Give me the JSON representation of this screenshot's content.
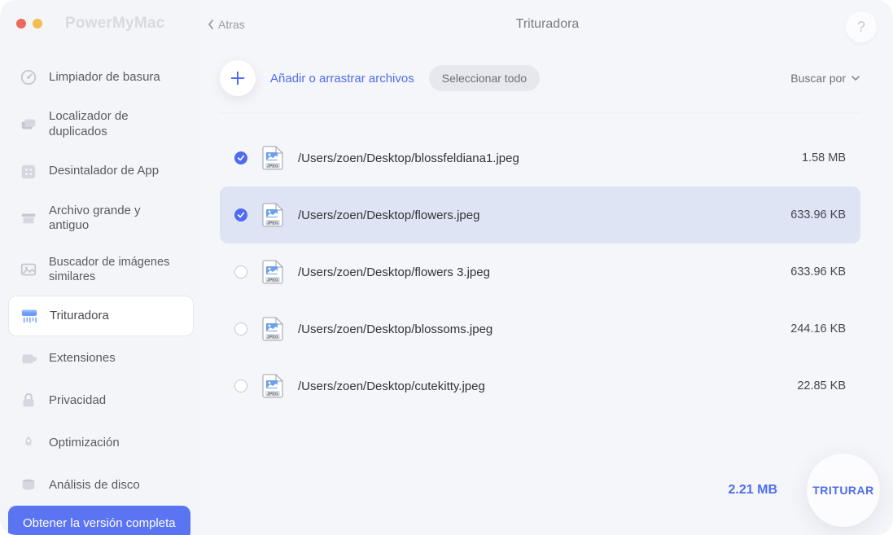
{
  "app_name": "PowerMyMac",
  "header": {
    "back_label": "Atras",
    "title": "Trituradora",
    "help_label": "?"
  },
  "sidebar": {
    "items": [
      {
        "label": "Limpiador de basura"
      },
      {
        "label": "Localizador de duplicados"
      },
      {
        "label": "Desintalador de App"
      },
      {
        "label": "Archivo grande y antiguo"
      },
      {
        "label": "Buscador de imágenes similares"
      },
      {
        "label": "Trituradora"
      },
      {
        "label": "Extensiones"
      },
      {
        "label": "Privacidad"
      },
      {
        "label": "Optimización"
      },
      {
        "label": "Análisis de disco"
      }
    ],
    "upgrade_label": "Obtener la versión completa"
  },
  "toolbar": {
    "add_label": "Añadir o arrastrar archivos",
    "select_all_label": "Seleccionar todo",
    "search_by_label": "Buscar por"
  },
  "files": [
    {
      "checked": true,
      "highlight": false,
      "path": "/Users/zoen/Desktop/blossfeldiana1.jpeg",
      "size": "1.58 MB"
    },
    {
      "checked": true,
      "highlight": true,
      "path": "/Users/zoen/Desktop/flowers.jpeg",
      "size": "633.96 KB"
    },
    {
      "checked": false,
      "highlight": false,
      "path": "/Users/zoen/Desktop/flowers 3.jpeg",
      "size": "633.96 KB"
    },
    {
      "checked": false,
      "highlight": false,
      "path": "/Users/zoen/Desktop/blossoms.jpeg",
      "size": "244.16 KB"
    },
    {
      "checked": false,
      "highlight": false,
      "path": "/Users/zoen/Desktop/cutekitty.jpeg",
      "size": "22.85 KB"
    }
  ],
  "footer": {
    "total_size": "2.21 MB",
    "action_label": "TRITURAR"
  },
  "colors": {
    "accent": "#4f6cf0",
    "row_highlight": "#dfe4f5"
  }
}
